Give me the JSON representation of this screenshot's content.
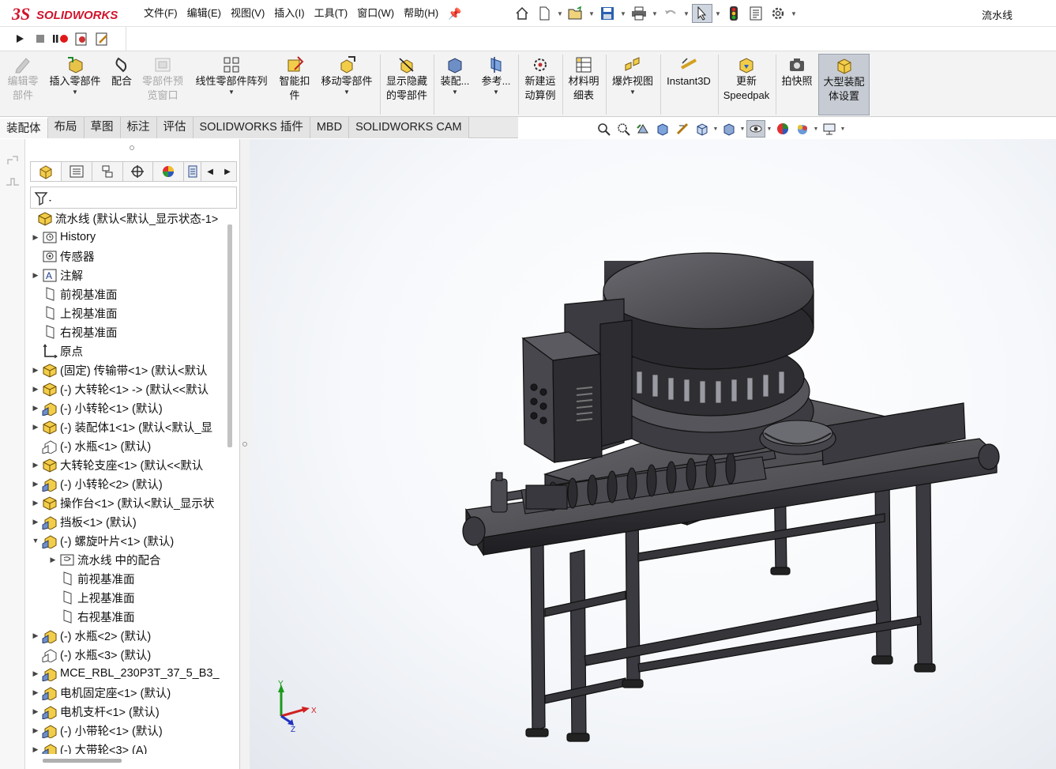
{
  "app": {
    "brand": "SOLIDWORKS",
    "document_title": "流水线"
  },
  "menus": [
    "文件(F)",
    "编辑(E)",
    "视图(V)",
    "插入(I)",
    "工具(T)",
    "窗口(W)",
    "帮助(H)"
  ],
  "quick_access_icons": [
    "home-icon",
    "new-document-icon",
    "open-icon",
    "save-icon",
    "print-icon",
    "undo-icon",
    "select-icon",
    "rebuild-icon",
    "file-properties-icon",
    "options-icon"
  ],
  "macro_icons": [
    "run-macro-icon",
    "stop-macro-icon",
    "record-macro-icon",
    "new-macro-icon",
    "edit-macro-icon"
  ],
  "command_manager": [
    {
      "label": "编辑零\n部件",
      "icon": "edit-component-icon",
      "enabled": false,
      "dropdown": false
    },
    {
      "label": "插入零部件",
      "icon": "insert-component-icon",
      "enabled": true,
      "dropdown": true
    },
    {
      "label": "配合",
      "icon": "mate-icon",
      "enabled": true,
      "dropdown": false
    },
    {
      "label": "零部件预\n览窗口",
      "icon": "component-preview-icon",
      "enabled": false,
      "dropdown": false
    },
    {
      "label": "线性零部件阵列",
      "icon": "linear-pattern-icon",
      "enabled": true,
      "dropdown": true
    },
    {
      "label": "智能扣\n件",
      "icon": "smart-fasteners-icon",
      "enabled": true,
      "dropdown": false
    },
    {
      "label": "移动零部件",
      "icon": "move-component-icon",
      "enabled": true,
      "dropdown": true
    },
    {
      "label": "显示隐藏\n的零部件",
      "icon": "show-hidden-icon",
      "enabled": true,
      "dropdown": false
    },
    {
      "label": "装配...",
      "icon": "assembly-features-icon",
      "enabled": true,
      "dropdown": true
    },
    {
      "label": "参考...",
      "icon": "reference-geometry-icon",
      "enabled": true,
      "dropdown": true
    },
    {
      "label": "新建运\n动算例",
      "icon": "new-motion-study-icon",
      "enabled": true,
      "dropdown": false
    },
    {
      "label": "材料明\n细表",
      "icon": "bill-of-materials-icon",
      "enabled": true,
      "dropdown": false
    },
    {
      "label": "爆炸视图",
      "icon": "exploded-view-icon",
      "enabled": true,
      "dropdown": true
    },
    {
      "label": "Instant3D",
      "icon": "instant3d-icon",
      "enabled": true,
      "dropdown": false
    },
    {
      "label": "更新\nSpeedpak",
      "icon": "update-speedpak-icon",
      "enabled": true,
      "dropdown": false
    },
    {
      "label": "拍快照",
      "icon": "snapshot-icon",
      "enabled": true,
      "dropdown": false
    },
    {
      "label": "大型装配\n体设置",
      "icon": "large-assembly-settings-icon",
      "enabled": true,
      "dropdown": false,
      "active": true
    }
  ],
  "tabs": [
    {
      "label": "装配体",
      "active": true
    },
    {
      "label": "布局",
      "active": false
    },
    {
      "label": "草图",
      "active": false
    },
    {
      "label": "标注",
      "active": false
    },
    {
      "label": "评估",
      "active": false
    },
    {
      "label": "SOLIDWORKS 插件",
      "active": false
    },
    {
      "label": "MBD",
      "active": false
    },
    {
      "label": "SOLIDWORKS CAM",
      "active": false
    }
  ],
  "view_toolbar_icons": [
    "zoom-to-fit-icon",
    "zoom-to-area-icon",
    "previous-view-icon",
    "section-view-icon",
    "dynamic-annotation-icon",
    "view-orientation-icon",
    "display-style-icon",
    "hide-show-items-icon",
    "edit-appearance-icon",
    "apply-scene-icon",
    "view-settings-icon"
  ],
  "panel_tabs": [
    "featuremanager-icon",
    "propertymanager-icon",
    "configurationmanager-icon",
    "dimxpertmanager-icon",
    "displaymanager-icon",
    "cam-manager-icon"
  ],
  "tree": [
    {
      "text": "流水线 (默认<默认_显示状态-1>",
      "icon": "assembly-icon",
      "indent": 0,
      "expander": ""
    },
    {
      "text": "History",
      "icon": "history-icon",
      "indent": 1,
      "expander": "▶"
    },
    {
      "text": "传感器",
      "icon": "sensor-icon",
      "indent": 1,
      "expander": ""
    },
    {
      "text": "注解",
      "icon": "annotations-icon",
      "indent": 1,
      "expander": "▶"
    },
    {
      "text": "前视基准面",
      "icon": "plane-icon",
      "indent": 1,
      "expander": ""
    },
    {
      "text": "上视基准面",
      "icon": "plane-icon",
      "indent": 1,
      "expander": ""
    },
    {
      "text": "右视基准面",
      "icon": "plane-icon",
      "indent": 1,
      "expander": ""
    },
    {
      "text": "原点",
      "icon": "origin-icon",
      "indent": 1,
      "expander": ""
    },
    {
      "text": "(固定) 传输带<1> (默认<默认",
      "icon": "subassembly-icon",
      "indent": 1,
      "expander": "▶"
    },
    {
      "text": "(-) 大转轮<1> -> (默认<<默认",
      "icon": "subassembly-icon",
      "indent": 1,
      "expander": "▶"
    },
    {
      "text": "(-) 小转轮<1> (默认)",
      "icon": "part-icon",
      "indent": 1,
      "expander": "▶"
    },
    {
      "text": "(-) 装配体1<1> (默认<默认_显",
      "icon": "subassembly-icon",
      "indent": 1,
      "expander": "▶"
    },
    {
      "text": "(-) 水瓶<1> (默认)",
      "icon": "part-outline-icon",
      "indent": 1,
      "expander": ""
    },
    {
      "text": "大转轮支座<1> (默认<<默认",
      "icon": "subassembly-icon",
      "indent": 1,
      "expander": "▶"
    },
    {
      "text": "(-) 小转轮<2> (默认)",
      "icon": "part-icon",
      "indent": 1,
      "expander": "▶"
    },
    {
      "text": "操作台<1> (默认<默认_显示状",
      "icon": "subassembly-icon",
      "indent": 1,
      "expander": "▶"
    },
    {
      "text": "挡板<1> (默认)",
      "icon": "part-icon",
      "indent": 1,
      "expander": "▶"
    },
    {
      "text": "(-) 螺旋叶片<1> (默认)",
      "icon": "part-icon",
      "indent": 1,
      "expander": "▼"
    },
    {
      "text": "流水线 中的配合",
      "icon": "mates-folder-icon",
      "indent": 2,
      "expander": "▶"
    },
    {
      "text": "前视基准面",
      "icon": "plane-icon",
      "indent": 2,
      "expander": ""
    },
    {
      "text": "上视基准面",
      "icon": "plane-icon",
      "indent": 2,
      "expander": ""
    },
    {
      "text": "右视基准面",
      "icon": "plane-icon",
      "indent": 2,
      "expander": ""
    },
    {
      "text": "(-) 水瓶<2> (默认)",
      "icon": "part-icon",
      "indent": 1,
      "expander": "▶"
    },
    {
      "text": "(-) 水瓶<3> (默认)",
      "icon": "part-outline-icon",
      "indent": 1,
      "expander": ""
    },
    {
      "text": "MCE_RBL_230P3T_37_5_B3_",
      "icon": "part-icon",
      "indent": 1,
      "expander": "▶"
    },
    {
      "text": "电机固定座<1> (默认)",
      "icon": "part-icon",
      "indent": 1,
      "expander": "▶"
    },
    {
      "text": "电机支杆<1> (默认)",
      "icon": "part-icon",
      "indent": 1,
      "expander": "▶"
    },
    {
      "text": "(-) 小带轮<1> (默认)",
      "icon": "part-icon",
      "indent": 1,
      "expander": "▶"
    },
    {
      "text": "(-) 大带轮<3> (A)",
      "icon": "part-icon",
      "indent": 1,
      "expander": "▶"
    }
  ],
  "triad": {
    "x_label": "X",
    "y_label": "Y",
    "z_label": "Z"
  },
  "colors": {
    "brand_red": "#d0142c",
    "model_dark": "#3a3a3e",
    "active_cmd": "#c7ccd4",
    "triad_x": "#d02020",
    "triad_y": "#1a9a1a",
    "triad_z": "#2030c0"
  }
}
